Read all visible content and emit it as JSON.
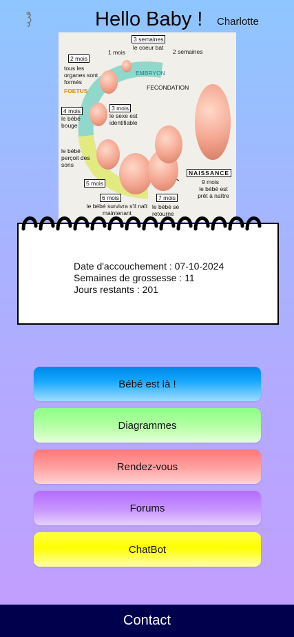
{
  "header": {
    "title": "Hello Baby !",
    "user_name": "Charlotte",
    "icon": "baby-icon"
  },
  "illustration": {
    "labels": {
      "m1": "1 mois",
      "w3": "3 semaines",
      "w3b": "le coeur bat",
      "w2": "2 semaines",
      "m2": "2 mois",
      "m2txt": "tous les organes sont formés",
      "fetus": "FOETUS",
      "embryon": "EMBRYON",
      "fecondation": "FECONDATION",
      "m4": "4 mois",
      "m4txt": "le bébé bouge",
      "m3": "3 mois",
      "m3txt": "le sexe est identifiable",
      "percoit": "le bébé perçoit des sons",
      "m5": "5 mois",
      "naissance": "NAISSANCE",
      "m9": "9 mois",
      "m9txt": "le bébé est prêt à naître",
      "m6": "6 mois",
      "m6txt": "le bébé survivra s'il naît maintenant",
      "m7": "7 mois",
      "m7txt": "le bébé se retourne"
    }
  },
  "pregnancy_info": {
    "due_date": "Date d'accouchement : 07-10-2024",
    "weeks": "Semaines de grossesse : 11",
    "days_left": "Jours restants : 201"
  },
  "buttons": {
    "baby_here": "Bébé est là !",
    "diagrams": "Diagrammes",
    "appointments": "Rendez-vous",
    "forums": "Forums",
    "chatbot": "ChatBot"
  },
  "footer": {
    "contact": "Contact"
  }
}
